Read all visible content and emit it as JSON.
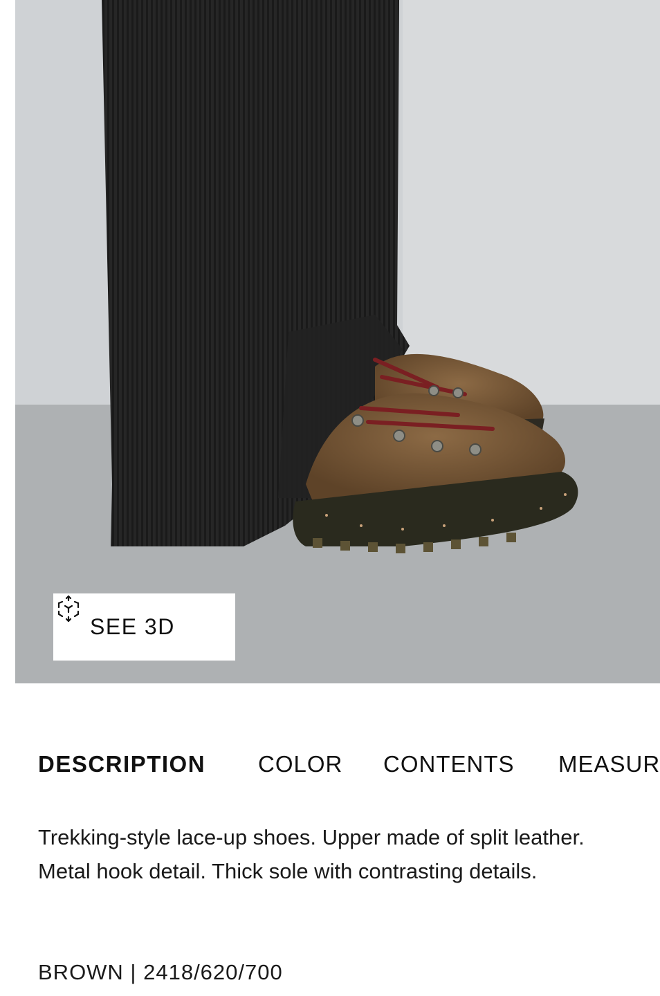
{
  "product": {
    "image_alt": "Trekking-style lace-up shoes"
  },
  "viewer": {
    "see_3d_label": "SEE 3D",
    "icon": "cube-3d-icon"
  },
  "tabs": [
    {
      "label": "DESCRIPTION",
      "active": true
    },
    {
      "label": "COLOR",
      "active": false
    },
    {
      "label": "CONTENTS",
      "active": false
    },
    {
      "label": "MEASUREMENTS",
      "active": false
    }
  ],
  "description": {
    "text": "Trekking-style lace-up shoes. Upper made of split leather. Metal hook detail. Thick sole with contrasting details.",
    "color_ref": "BROWN | 2418/620/700"
  },
  "colors": {
    "text": "#111111",
    "background": "#ffffff"
  }
}
